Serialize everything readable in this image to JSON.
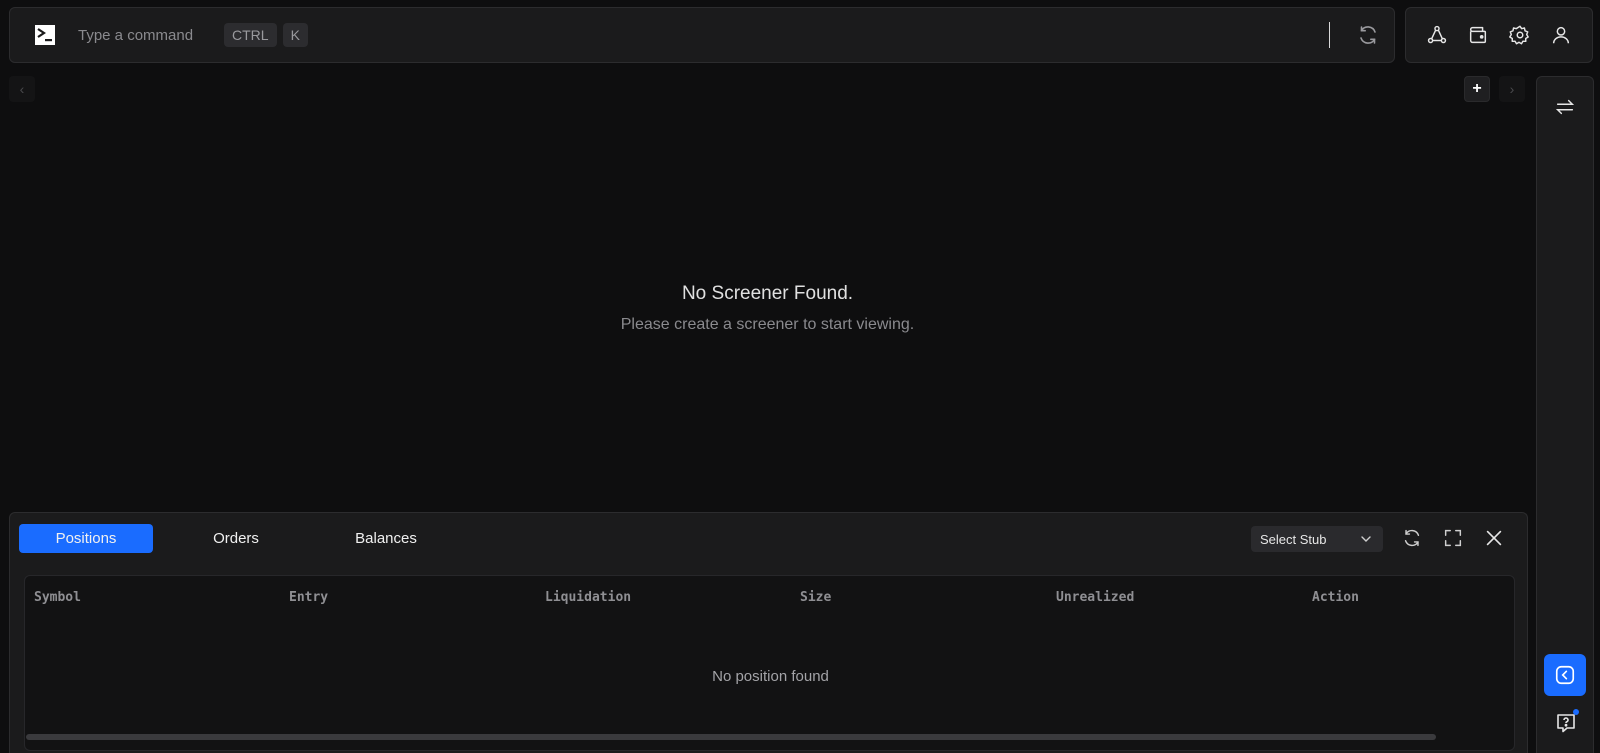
{
  "command_bar": {
    "placeholder": "Type a command",
    "shortcut_keys": [
      "CTRL",
      "K"
    ]
  },
  "header_icons": [
    "network-icon",
    "wallet-icon",
    "settings-icon",
    "user-icon"
  ],
  "main": {
    "prev_symbol": "‹",
    "next_symbol": "›",
    "add_symbol": "+",
    "empty_title": "No Screener Found.",
    "empty_subtitle": "Please create a screener to start viewing."
  },
  "bottom_panel": {
    "tabs": [
      {
        "label": "Positions",
        "active": true
      },
      {
        "label": "Orders",
        "active": false
      },
      {
        "label": "Balances",
        "active": false
      }
    ],
    "stub_select": "Select Stub",
    "table": {
      "columns": [
        "Symbol",
        "Entry",
        "Liquidation",
        "Size",
        "Unrealized",
        "Action"
      ],
      "rows": [],
      "empty_message": "No position found"
    }
  },
  "colors": {
    "accent": "#1a6cff",
    "background": "#0e0e0f",
    "panel": "#1b1b1c"
  }
}
